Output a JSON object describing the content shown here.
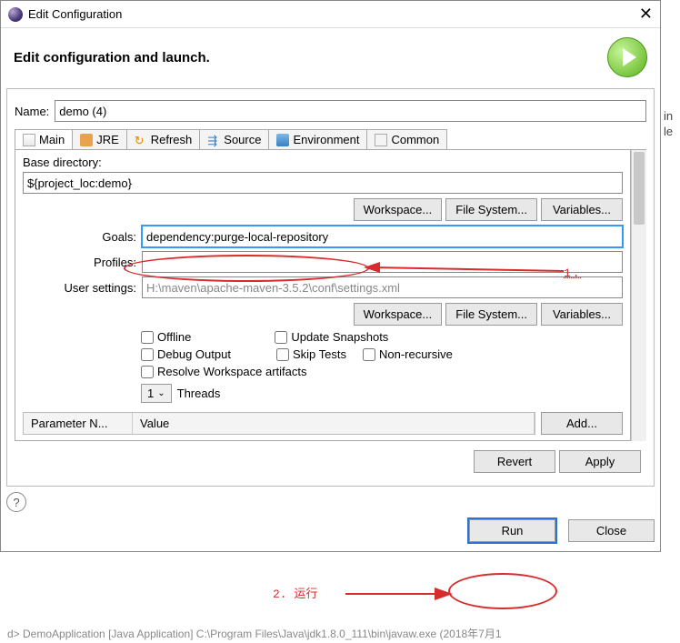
{
  "title": "Edit Configuration",
  "heading": "Edit configuration and launch.",
  "name_label": "Name:",
  "name_value": "demo (4)",
  "tabs": {
    "main": "Main",
    "jre": "JRE",
    "refresh": "Refresh",
    "source": "Source",
    "environment": "Environment",
    "common": "Common"
  },
  "main": {
    "base_dir_label": "Base directory:",
    "base_dir_value": "${project_loc:demo}",
    "workspace_btn": "Workspace...",
    "filesystem_btn": "File System...",
    "variables_btn": "Variables...",
    "goals_label": "Goals:",
    "goals_value": "dependency:purge-local-repository",
    "profiles_label": "Profiles:",
    "profiles_value": "",
    "user_settings_label": "User settings:",
    "user_settings_value": "H:\\maven\\apache-maven-3.5.2\\conf\\settings.xml",
    "checks": {
      "offline": "Offline",
      "update_snapshots": "Update Snapshots",
      "debug_output": "Debug Output",
      "skip_tests": "Skip Tests",
      "non_recursive": "Non-recursive",
      "resolve_ws": "Resolve Workspace artifacts"
    },
    "threads_value": "1",
    "threads_label": "Threads",
    "param_name_col": "Parameter N...",
    "value_col": "Value",
    "add_btn": "Add..."
  },
  "footer": {
    "revert": "Revert",
    "apply": "Apply",
    "run": "Run",
    "close": "Close"
  },
  "annotations": {
    "label1": "1.",
    "label2": "2. 运行"
  },
  "bottom_text": "d> DemoApplication [Java Application] C:\\Program Files\\Java\\jdk1.8.0_111\\bin\\javaw.exe (2018年7月1",
  "bg1": "in",
  "bg2": "le"
}
